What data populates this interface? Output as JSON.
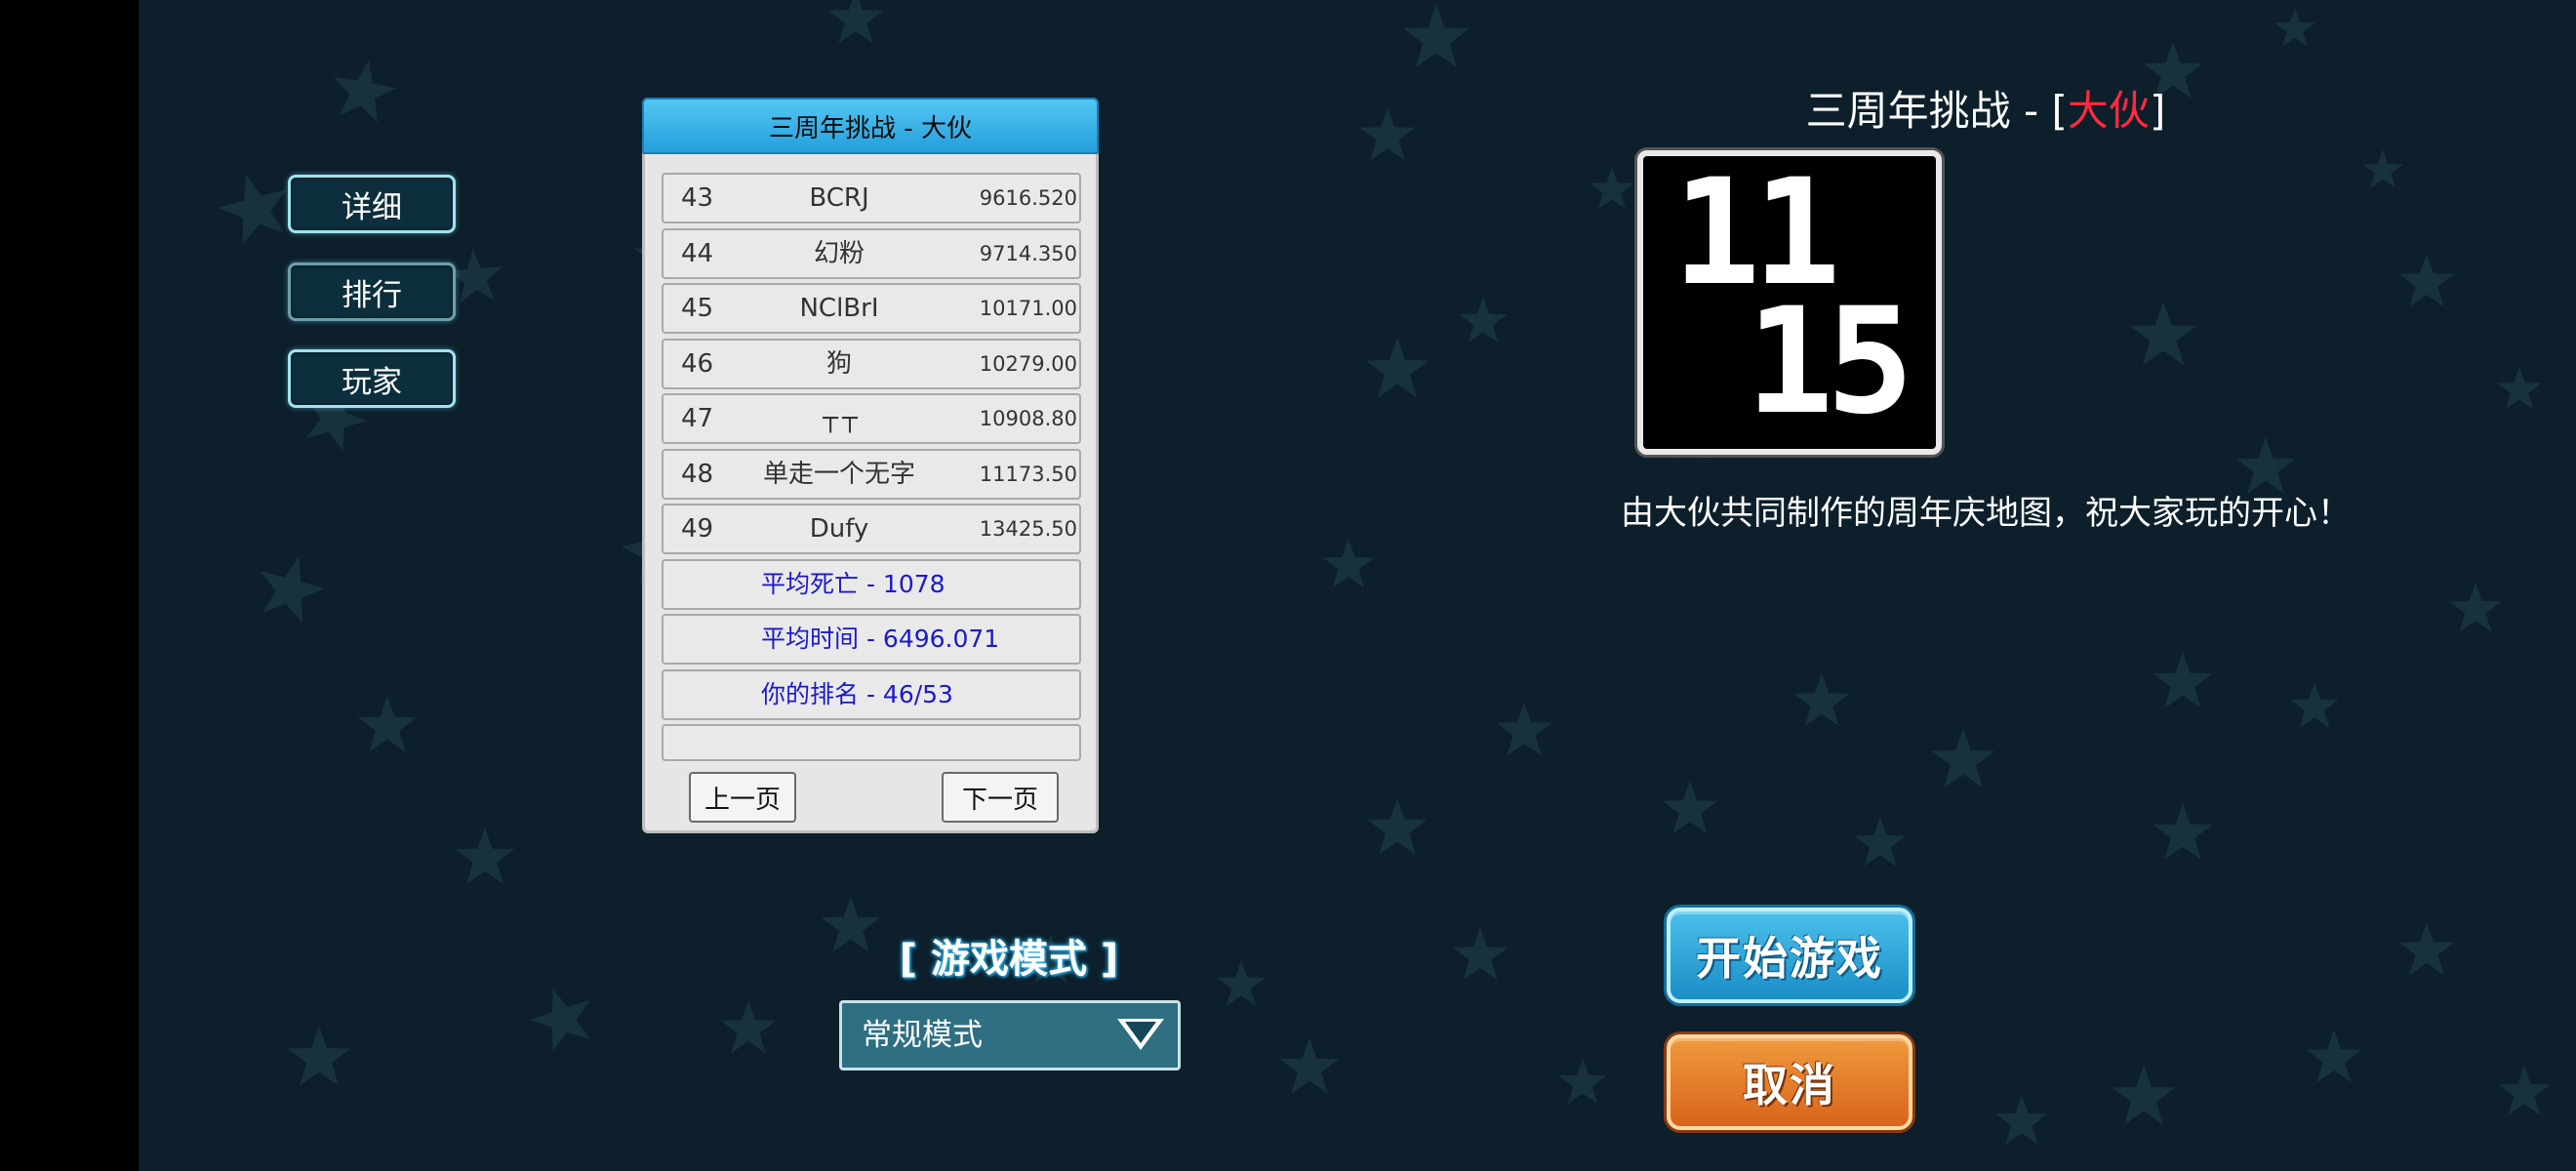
{
  "tabs": {
    "detail": "详细",
    "ranking": "排行",
    "players": "玩家"
  },
  "leaderboard": {
    "title": "三周年挑战 - 大伙",
    "rows": [
      {
        "rank": "43",
        "name": "BCRJ",
        "score": "9616.520"
      },
      {
        "rank": "44",
        "name": "幻粉",
        "score": "9714.350"
      },
      {
        "rank": "45",
        "name": "NClBrI",
        "score": "10171.00"
      },
      {
        "rank": "46",
        "name": "狗",
        "score": "10279.00"
      },
      {
        "rank": "47",
        "name": "┬  ┬",
        "score": "10908.80"
      },
      {
        "rank": "48",
        "name": "单走一个无字",
        "score": "11173.50"
      },
      {
        "rank": "49",
        "name": "Dufy",
        "score": "13425.50"
      }
    ],
    "stats": {
      "avg_deaths": "平均死亡 - 1078",
      "avg_time": "平均时间 - 6496.071",
      "your_rank": "你的排名 - 46/53"
    },
    "prev_page": "上一页",
    "next_page": "下一页"
  },
  "map": {
    "title_prefix": "三周年挑战 - [",
    "title_highlight": "大伙",
    "title_suffix": "]",
    "thumbnail_text": [
      "11",
      "15"
    ],
    "description": "由大伙共同制作的周年庆地图，祝大家玩的开心！"
  },
  "mode": {
    "label": "[ 游戏模式 ]",
    "selected": "常规模式"
  },
  "buttons": {
    "start": "开始游戏",
    "cancel": "取消"
  },
  "colors": {
    "background": "#0c1f2b",
    "title_highlight": "#ff2a3c",
    "stat_text": "#1a1acb",
    "start_button": "#2aa5da",
    "cancel_button": "#e27a28"
  }
}
